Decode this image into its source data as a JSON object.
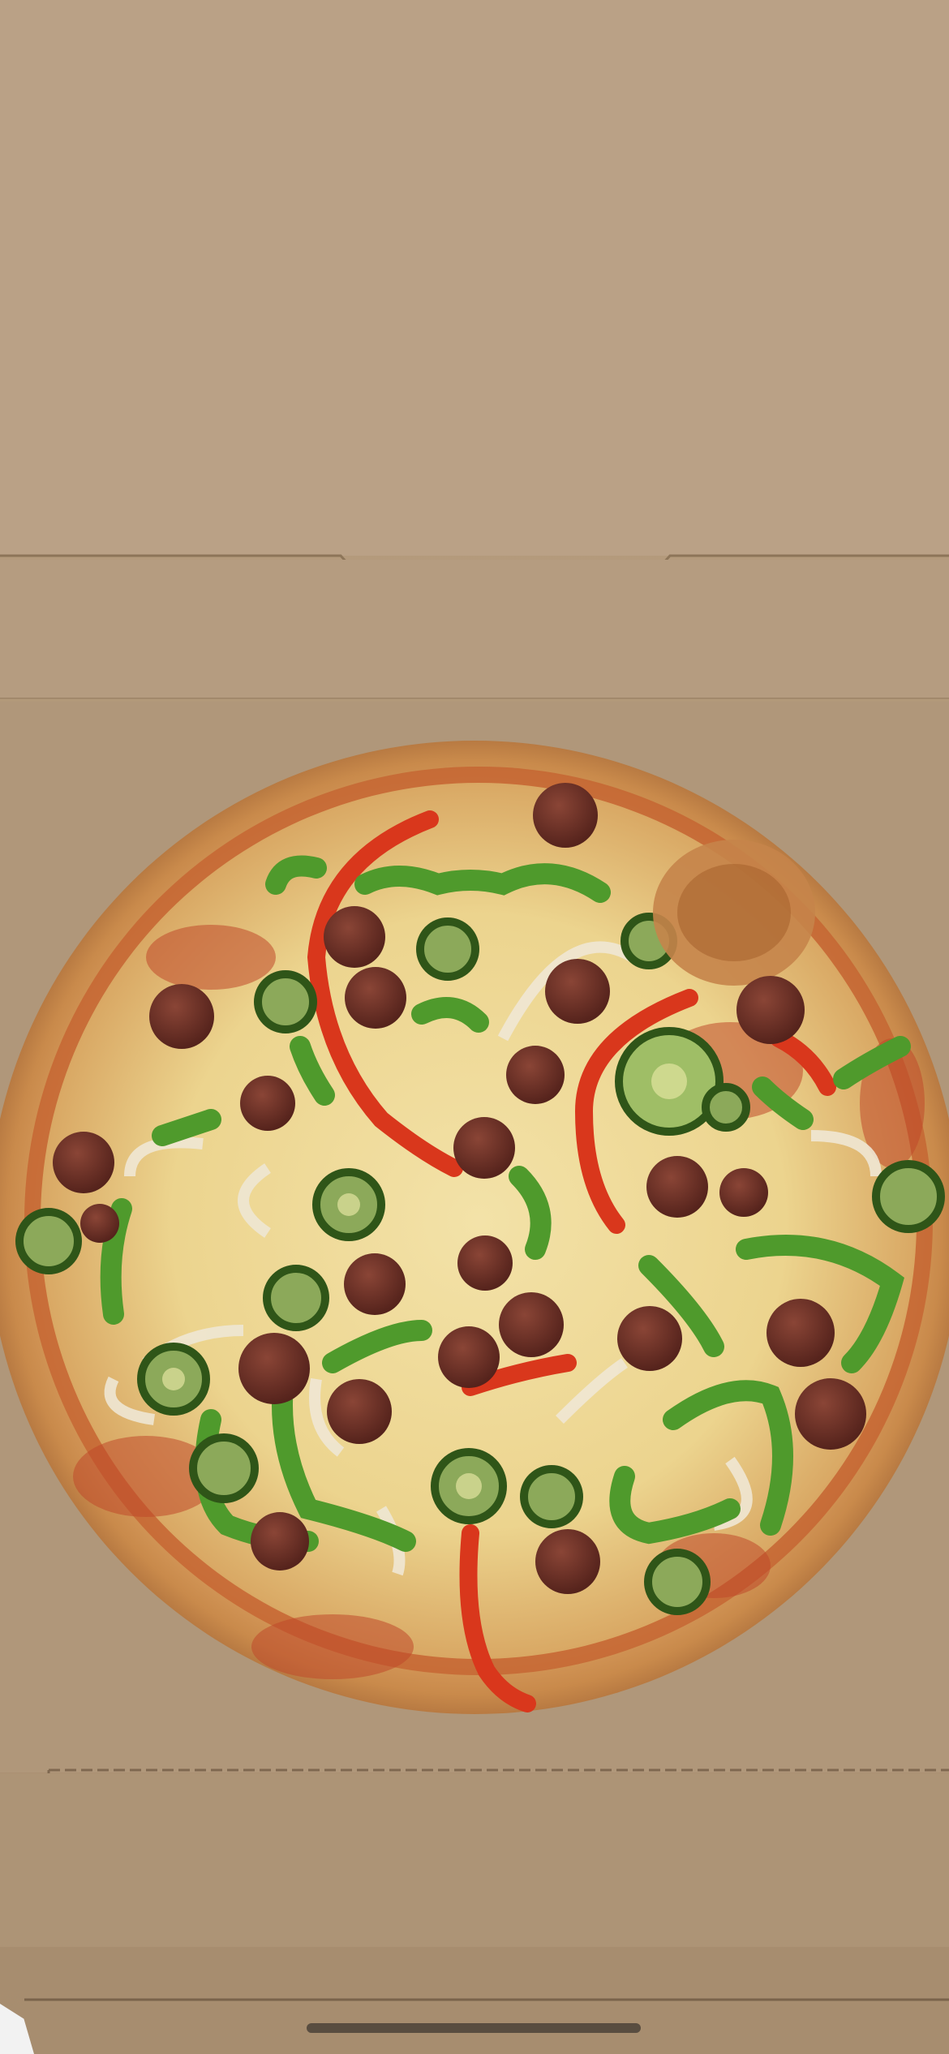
{
  "scene": {
    "subject": "pizza-in-cardboard-box",
    "toppings": [
      "sausage-slice",
      "jalapeno-ring",
      "green-pepper",
      "red-pepper",
      "onion"
    ]
  },
  "colors": {
    "cardboard": "#b39a7e",
    "crust": "#d9a468",
    "cheese": "#efdca0",
    "sauce": "#c0492a",
    "sausage": "#6b2f27",
    "jalapeno": "#3f6b25",
    "green_pepper": "#4f9a2c",
    "red_pepper": "#d9371c",
    "onion": "#e8e1cf"
  }
}
